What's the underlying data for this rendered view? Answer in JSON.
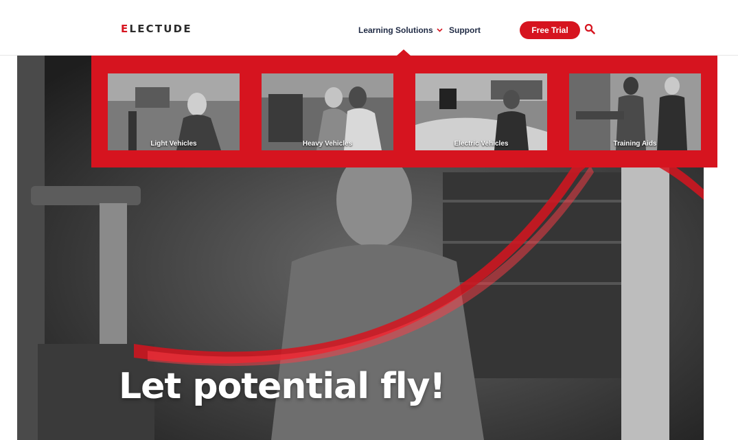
{
  "header": {
    "logo_accent": "E",
    "logo_rest": "LECTUDE",
    "nav": {
      "learning_solutions": "Learning Solutions",
      "support": "Support"
    },
    "cta_label": "Free Trial",
    "icons": {
      "dropdown": "chevron-down-icon",
      "search": "search-icon"
    }
  },
  "mega_menu": {
    "items": [
      {
        "label": "Light Vehicles"
      },
      {
        "label": "Heavy Vehicles"
      },
      {
        "label": "Electric Vehicles"
      },
      {
        "label": "Training Aids"
      }
    ]
  },
  "hero": {
    "headline": "Let potential fly!"
  },
  "colors": {
    "brand_red": "#d6141f",
    "nav_text": "#1f2a44"
  }
}
